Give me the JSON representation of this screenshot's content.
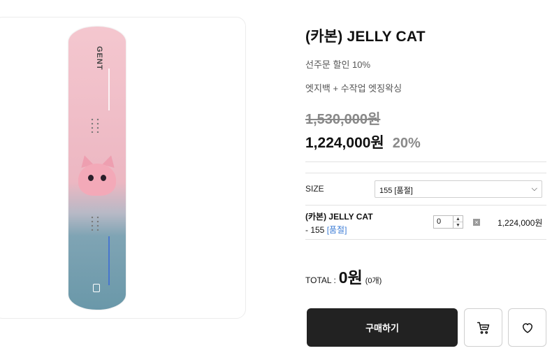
{
  "product": {
    "title": "(카본) JELLY CAT",
    "note_preorder": "선주문 할인 10%",
    "note_service": "엣지백 + 수작업 엣징왁싱",
    "original_price": "1,530,000원",
    "sale_price": "1,224,000원",
    "discount": "20%"
  },
  "board": {
    "logo_text": "GENT"
  },
  "size_option": {
    "label": "SIZE",
    "selected": "155 [품절]"
  },
  "selected_option": {
    "name": "(카본) JELLY CAT",
    "variant_prefix": "- 155 ",
    "variant_value": "[품절]",
    "quantity": "0",
    "price": "1,224,000원"
  },
  "total": {
    "label": "TOTAL :",
    "amount": "0원",
    "count": "(0개)"
  },
  "actions": {
    "buy_label": "구매하기"
  },
  "colors": {
    "buy_button_bg": "#222222",
    "variant_link": "#3a7bd5",
    "discount_text": "#8a8a8a"
  },
  "icons": {
    "cart": "cart-icon",
    "wishlist": "heart-icon",
    "remove": "close-icon"
  }
}
